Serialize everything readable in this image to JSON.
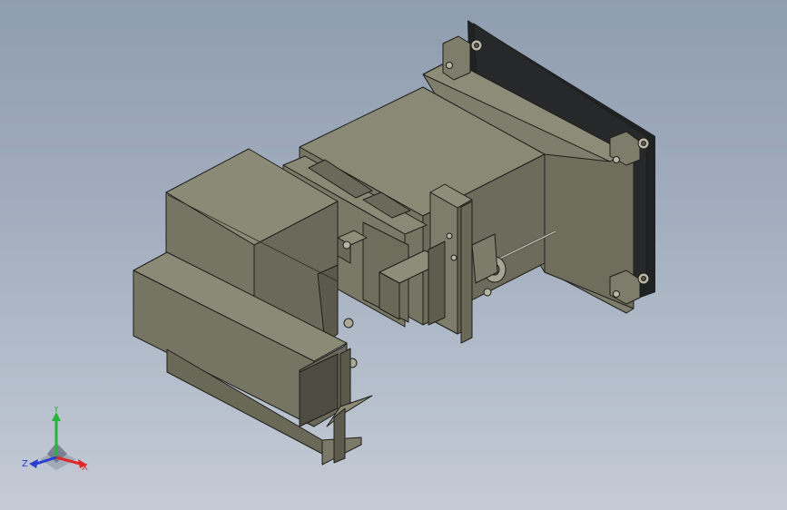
{
  "viewport": {
    "background_top": "#8f9db0",
    "background_bottom": "#c4cbd6",
    "model_color": "#7c7b6a",
    "edge_color": "#1e1e1a"
  },
  "triad": {
    "x_label": "X",
    "y_label": "Y",
    "z_label": "Z",
    "x_color": "#e0262b",
    "y_color": "#27b43a",
    "z_color": "#2a3fd1"
  }
}
